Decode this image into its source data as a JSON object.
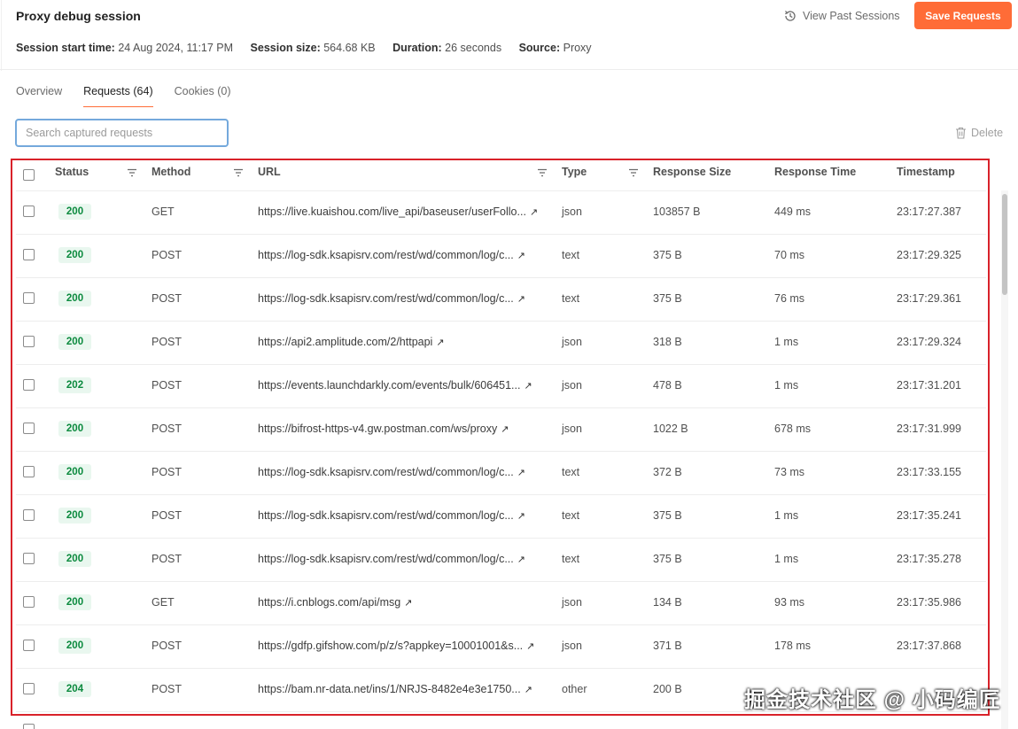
{
  "session": {
    "title": "Proxy debug session",
    "view_past_label": "View Past Sessions",
    "save_label": "Save Requests",
    "meta": {
      "start_label": "Session start time:",
      "start_value": "24 Aug 2024, 11:17 PM",
      "size_label": "Session size:",
      "size_value": "564.68 KB",
      "duration_label": "Duration:",
      "duration_value": "26 seconds",
      "source_label": "Source:",
      "source_value": "Proxy"
    }
  },
  "tabs": [
    {
      "label": "Overview",
      "active": false
    },
    {
      "label": "Requests (64)",
      "active": true
    },
    {
      "label": "Cookies (0)",
      "active": false
    }
  ],
  "search": {
    "placeholder": "Search captured requests",
    "value": ""
  },
  "delete_label": "Delete",
  "columns": {
    "status": "Status",
    "method": "Method",
    "url": "URL",
    "type": "Type",
    "response_size": "Response Size",
    "response_time": "Response Time",
    "timestamp": "Timestamp"
  },
  "rows": [
    {
      "status": "200",
      "method": "GET",
      "url": "https://live.kuaishou.com/live_api/baseuser/userFollo...",
      "type": "json",
      "size": "103857 B",
      "time": "449 ms",
      "timestamp": "23:17:27.387"
    },
    {
      "status": "200",
      "method": "POST",
      "url": "https://log-sdk.ksapisrv.com/rest/wd/common/log/c...",
      "type": "text",
      "size": "375 B",
      "time": "70 ms",
      "timestamp": "23:17:29.325"
    },
    {
      "status": "200",
      "method": "POST",
      "url": "https://log-sdk.ksapisrv.com/rest/wd/common/log/c...",
      "type": "text",
      "size": "375 B",
      "time": "76 ms",
      "timestamp": "23:17:29.361"
    },
    {
      "status": "200",
      "method": "POST",
      "url": "https://api2.amplitude.com/2/httpapi",
      "type": "json",
      "size": "318 B",
      "time": "1 ms",
      "timestamp": "23:17:29.324"
    },
    {
      "status": "202",
      "method": "POST",
      "url": "https://events.launchdarkly.com/events/bulk/606451...",
      "type": "json",
      "size": "478 B",
      "time": "1 ms",
      "timestamp": "23:17:31.201"
    },
    {
      "status": "200",
      "method": "POST",
      "url": "https://bifrost-https-v4.gw.postman.com/ws/proxy",
      "type": "json",
      "size": "1022 B",
      "time": "678 ms",
      "timestamp": "23:17:31.999"
    },
    {
      "status": "200",
      "method": "POST",
      "url": "https://log-sdk.ksapisrv.com/rest/wd/common/log/c...",
      "type": "text",
      "size": "372 B",
      "time": "73 ms",
      "timestamp": "23:17:33.155"
    },
    {
      "status": "200",
      "method": "POST",
      "url": "https://log-sdk.ksapisrv.com/rest/wd/common/log/c...",
      "type": "text",
      "size": "375 B",
      "time": "1 ms",
      "timestamp": "23:17:35.241"
    },
    {
      "status": "200",
      "method": "POST",
      "url": "https://log-sdk.ksapisrv.com/rest/wd/common/log/c...",
      "type": "text",
      "size": "375 B",
      "time": "1 ms",
      "timestamp": "23:17:35.278"
    },
    {
      "status": "200",
      "method": "GET",
      "url": "https://i.cnblogs.com/api/msg",
      "type": "json",
      "size": "134 B",
      "time": "93 ms",
      "timestamp": "23:17:35.986"
    },
    {
      "status": "200",
      "method": "POST",
      "url": "https://gdfp.gifshow.com/p/z/s?appkey=10001001&s...",
      "type": "json",
      "size": "371 B",
      "time": "178 ms",
      "timestamp": "23:17:37.868"
    },
    {
      "status": "204",
      "method": "POST",
      "url": "https://bam.nr-data.net/ins/1/NRJS-8482e4e3e1750...",
      "type": "other",
      "size": "200 B",
      "time": "",
      "timestamp": ""
    }
  ],
  "watermark": "掘金技术社区 @ 小码编匠",
  "colors": {
    "accent": "#ff6c37",
    "status_bg": "#e9f7ef",
    "status_text": "#0b8a3e",
    "highlight": "#d9222a",
    "search_border": "#74a9dc"
  }
}
